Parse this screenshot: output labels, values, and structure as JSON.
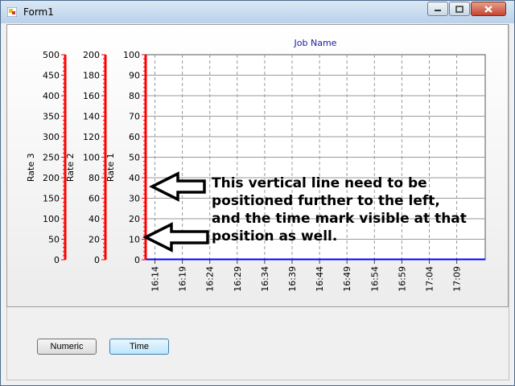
{
  "window": {
    "title": "Form1"
  },
  "chart": {
    "title": "Job Name",
    "axes": [
      {
        "name": "Rate 3",
        "ticks": [
          "500",
          "450",
          "400",
          "350",
          "300",
          "250",
          "200",
          "150",
          "100",
          "50",
          "0"
        ]
      },
      {
        "name": "Rate 2",
        "ticks": [
          "200",
          "180",
          "160",
          "140",
          "120",
          "100",
          "80",
          "60",
          "40",
          "20",
          "0"
        ]
      },
      {
        "name": "Rate 1",
        "ticks": [
          "100",
          "90",
          "80",
          "70",
          "60",
          "50",
          "40",
          "30",
          "20",
          "10",
          "0"
        ]
      }
    ],
    "time_ticks": [
      "16:14",
      "16:19",
      "16:24",
      "16:29",
      "16:34",
      "16:39",
      "16:44",
      "16:49",
      "16:54",
      "16:59",
      "17:04",
      "17:09"
    ]
  },
  "chart_data": {
    "type": "line",
    "title": "Job Name",
    "x": [
      "16:14",
      "16:19",
      "16:24",
      "16:29",
      "16:34",
      "16:39",
      "16:44",
      "16:49",
      "16:54",
      "16:59",
      "17:04",
      "17:09"
    ],
    "y_axes": [
      {
        "label": "Rate 3",
        "ylim": [
          0,
          500
        ]
      },
      {
        "label": "Rate 2",
        "ylim": [
          0,
          200
        ]
      },
      {
        "label": "Rate 1",
        "ylim": [
          0,
          100
        ]
      }
    ],
    "grid": true,
    "axis_color": "#ff0000",
    "series_color": "#0000ff"
  },
  "annotation": {
    "lines": [
      "This vertical line need to be",
      "positioned further to the left,",
      "and the time mark visible at that",
      "position as well."
    ]
  },
  "buttons": {
    "numeric": "Numeric",
    "time": "Time"
  }
}
